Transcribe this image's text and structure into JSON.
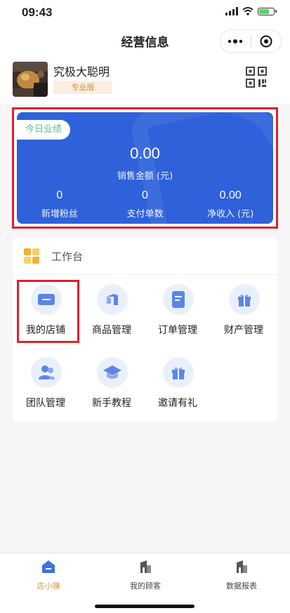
{
  "status_bar": {
    "time": "09:43",
    "battery_level": 0.75
  },
  "nav": {
    "title": "经营信息",
    "more_icon": "more-dots-icon",
    "close_icon": "target-circle-icon"
  },
  "profile": {
    "name": "究极大聪明",
    "edition": "专业版",
    "qr_icon": "qr-code-icon"
  },
  "performance": {
    "tag": "今日业绩",
    "sales_amount": "0.00",
    "sales_label": "销售金额 (元)",
    "stats": [
      {
        "value": "0",
        "label": "新增粉丝"
      },
      {
        "value": "0",
        "label": "支付单数"
      },
      {
        "value": "0.00",
        "label": "净收入 (元)"
      }
    ]
  },
  "workbench": {
    "title": "工作台",
    "items": [
      {
        "label": "我的店铺",
        "icon": "shop-icon"
      },
      {
        "label": "商品管理",
        "icon": "goods-icon"
      },
      {
        "label": "订单管理",
        "icon": "order-icon"
      },
      {
        "label": "财产管理",
        "icon": "gift-box-icon"
      },
      {
        "label": "团队管理",
        "icon": "team-icon"
      },
      {
        "label": "新手教程",
        "icon": "graduation-cap-icon"
      },
      {
        "label": "邀请有礼",
        "icon": "invite-gift-icon"
      }
    ]
  },
  "tabbar": {
    "items": [
      {
        "label": "店小赚",
        "icon": "home-icon",
        "active": true
      },
      {
        "label": "我的顾客",
        "icon": "customer-icon",
        "active": false
      },
      {
        "label": "数据报表",
        "icon": "report-icon",
        "active": false
      }
    ]
  },
  "colors": {
    "primary_blue": "#2f62da",
    "highlight_red": "#e0202c",
    "tab_active": "#d49a45",
    "tag_green": "#57c18a"
  }
}
